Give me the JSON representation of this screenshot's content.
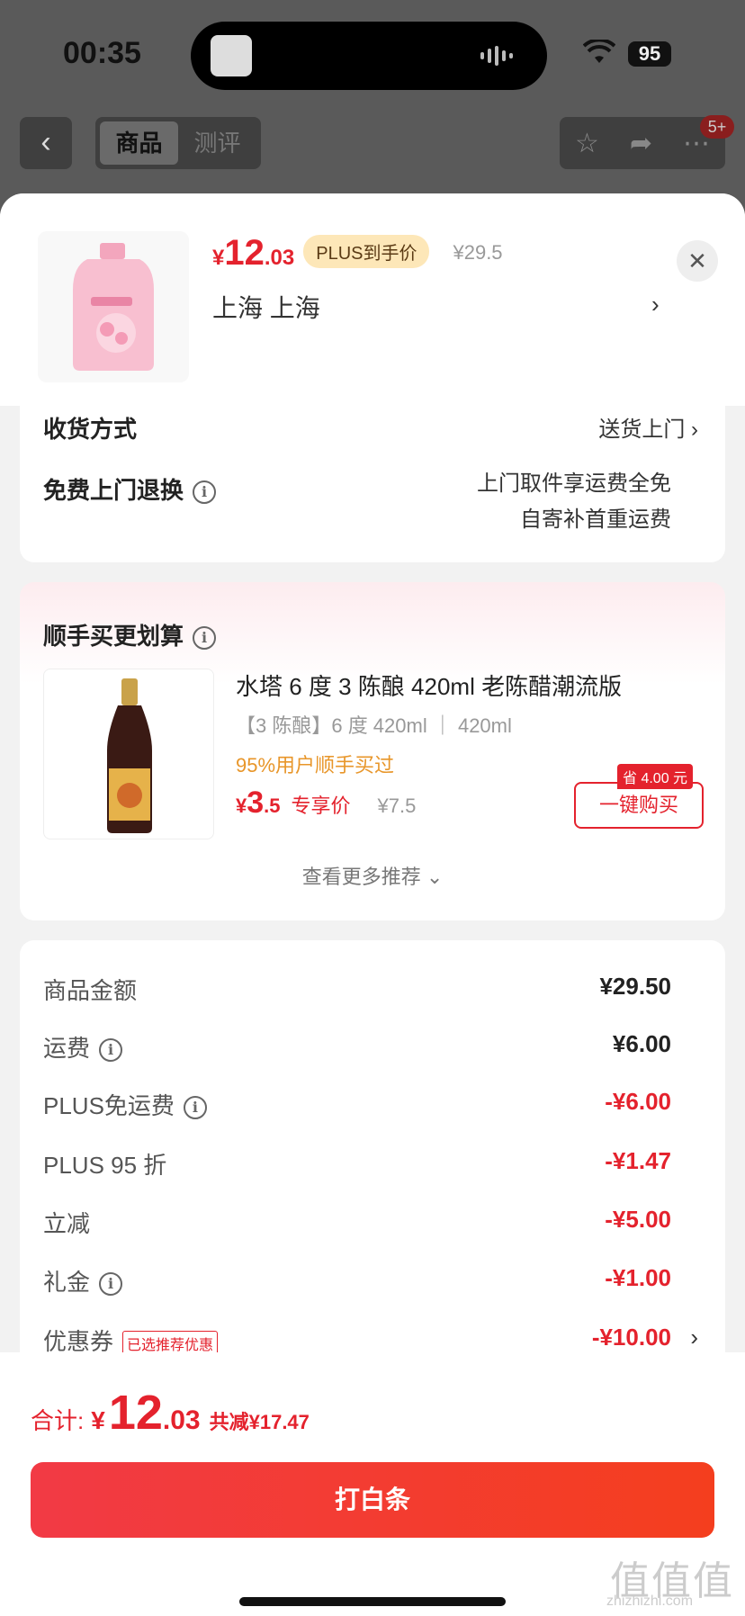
{
  "status": {
    "time": "00:35",
    "battery": "95"
  },
  "nav": {
    "tabs": [
      "商品",
      "测评"
    ],
    "badge": "5+"
  },
  "product": {
    "price_symbol": "¥",
    "price_int": "12",
    "price_dec": ".03",
    "plus_tag": "PLUS到手价",
    "original_price": "¥29.5",
    "location": "上海  上海"
  },
  "shipping": {
    "method_label": "收货方式",
    "method_value": "送货上门 ›",
    "return_label": "免费上门退换",
    "return_line1": "上门取件享运费全免",
    "return_line2": "自寄补首重运费"
  },
  "reco": {
    "title": "顺手买更划算",
    "name": "水塔 6 度 3 陈酿 420ml 老陈醋潮流版",
    "spec": "【3 陈酿】6 度 420ml  ｜  420ml",
    "sold": "95%用户顺手买过",
    "price_symbol": "¥",
    "price_int": "3",
    "price_dec": ".5",
    "price_tag": "专享价",
    "original_price": "¥7.5",
    "save_tag": "省 4.00 元",
    "buy_label": "一键购买",
    "more_label": "查看更多推荐 ⌄"
  },
  "summary": {
    "rows": [
      {
        "label": "商品金额",
        "value": "¥29.50"
      },
      {
        "label": "运费",
        "value": "¥6.00"
      },
      {
        "label": "PLUS免运费",
        "value": "-¥6.00"
      },
      {
        "label": "PLUS 95 折",
        "value": "-¥1.47"
      },
      {
        "label": "立减",
        "value": "-¥5.00"
      },
      {
        "label": "礼金",
        "value": "-¥1.00"
      },
      {
        "label": "优惠券",
        "value": "-¥10.00",
        "tag": "已选推荐优惠"
      }
    ]
  },
  "footer": {
    "total_label": "合计:",
    "total_symbol": "¥",
    "total_int": "12",
    "total_dec": ".03",
    "saved": "共减¥17.47",
    "pay_label": "打白条"
  },
  "colors": {
    "accent": "#e4222d",
    "plus_bg": "#fde7b8",
    "sold_orange": "#e8962a"
  }
}
